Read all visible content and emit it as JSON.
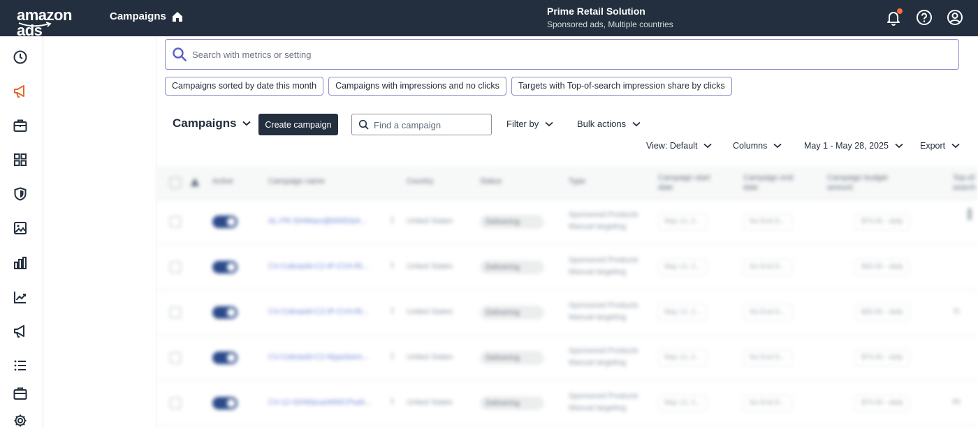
{
  "topbar": {
    "logo": "amazon ads",
    "nav_title": "Campaigns",
    "account_name": "Prime Retail Solution",
    "account_sub": "Sponsored ads, Multiple countries",
    "icons": [
      "home-icon",
      "bell-icon",
      "help-icon",
      "profile-icon"
    ],
    "notification_dot_color": "#ff6f3d"
  },
  "sidebar": {
    "icons": [
      "recent-clock-icon",
      "campaigns-megaphone-icon",
      "briefcase-icon",
      "apps-grid-icon",
      "brand-shield-icon",
      "media-image-icon",
      "measurement-bars-icon",
      "trends-chart-icon",
      "ads-megaphone-icon",
      "list-icon",
      "tools-briefcase-icon",
      "settings-gear-icon"
    ],
    "active_color": "#e0692f"
  },
  "search": {
    "placeholder": "Search with metrics or setting"
  },
  "chips": [
    "Campaigns sorted by date this month",
    "Campaigns with impressions and no clicks",
    "Targets with Top-of-search impression share by clicks"
  ],
  "toolbar": {
    "title": "Campaigns",
    "create_label": "Create campaign",
    "find_placeholder": "Find a campaign",
    "filter_label": "Filter by",
    "bulk_label": "Bulk actions",
    "view_label": "View: Default",
    "columns_label": "Columns",
    "date_label": "May 1 - May 28, 2025",
    "export_label": "Export"
  },
  "table": {
    "headers": [
      "Active",
      "Campaign name",
      "Country",
      "Status",
      "Type",
      "Campaign start date",
      "Campaign end date",
      "Campaign budget amount",
      "Top-of-search"
    ],
    "rows": [
      {
        "name": "AL-FR-SIHMaro@MWD&A...",
        "country": "United States",
        "status": "Delivering",
        "type1": "Sponsored Products",
        "type2": "Manual targeting",
        "start": "May 12, 2...",
        "end": "No End D...",
        "budget": "$70.00 - daily",
        "extra": ""
      },
      {
        "name": "CV-Cobraold-C2-IP-CV4-Rt...",
        "country": "United States",
        "status": "Delivering",
        "type1": "Sponsored Products",
        "type2": "Manual targeting",
        "start": "May 12, 2...",
        "end": "No End D...",
        "budget": "$30.00 - daily",
        "extra": ""
      },
      {
        "name": "CV-Cobraold-C2-IP-CV4-Rt...",
        "country": "United States",
        "status": "Delivering",
        "type1": "Sponsored Products",
        "type2": "Manual targeting",
        "start": "May 12, 2...",
        "end": "No End D...",
        "budget": "$30.00 - daily",
        "extra": "7t"
      },
      {
        "name": "CV-Cobraold-C2-Mypolsem...",
        "country": "United States",
        "status": "Delivering",
        "type1": "Sponsored Products",
        "type2": "Manual targeting",
        "start": "May 12, 2...",
        "end": "No End D...",
        "budget": "$70.00 - daily",
        "extra": ""
      },
      {
        "name": "CV-12-SIHMacaoMWCPsa6...",
        "country": "United States",
        "status": "Delivering",
        "type1": "Sponsored Products",
        "type2": "Manual targeting",
        "start": "May 12, 2...",
        "end": "No End D...",
        "budget": "$70.00 - daily",
        "extra": "Pt"
      }
    ]
  }
}
